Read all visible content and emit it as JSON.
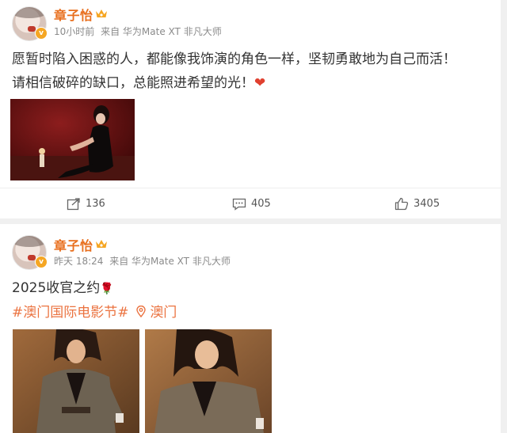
{
  "posts": [
    {
      "author": "章子怡",
      "time": "10小时前",
      "source": "来自 华为Mate XT 非凡大师",
      "text_line1": "愿暂时陷入困惑的人，都能像我饰演的角色一样，坚韧勇敢地为自己而活！",
      "text_line2": "请相信破碎的缺口，总能照进希望的光！",
      "emoji": "❤",
      "stats": {
        "repost": "136",
        "comment": "405",
        "like": "3405"
      }
    },
    {
      "author": "章子怡",
      "time": "昨天 18:24",
      "source": "来自 华为Mate XT 非凡大师",
      "text_line1": "2025收官之约",
      "emoji": "🌹",
      "topic": "#澳门国际电影节#",
      "location": "澳门"
    }
  ],
  "icons": {
    "verified": "verified-badge-icon",
    "crown": "crown-icon",
    "repost": "repost-icon",
    "comment": "comment-icon",
    "like": "thumbs-up-icon",
    "location": "location-pin-icon"
  },
  "colors": {
    "name": "#e86f1e",
    "topic": "#eb7340",
    "heart": "#e0402f",
    "background": "#f0f0f0"
  }
}
